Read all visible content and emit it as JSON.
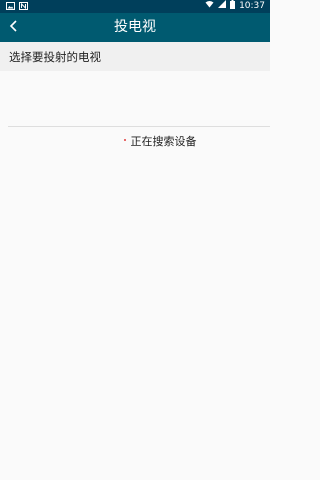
{
  "status_bar": {
    "time": "10:37",
    "icons_left": [
      "image-icon",
      "n-icon"
    ],
    "icons_right": [
      "wifi-icon",
      "signal-icon",
      "battery-icon"
    ]
  },
  "app_bar": {
    "title": "投电视"
  },
  "section": {
    "header": "选择要投射的电视"
  },
  "status": {
    "searching_text": "正在搜索设备"
  },
  "colors": {
    "status_bar": "#003f5b",
    "app_bar": "#005a70",
    "background": "#fafafa",
    "accent_dot": "#e23a3a"
  }
}
